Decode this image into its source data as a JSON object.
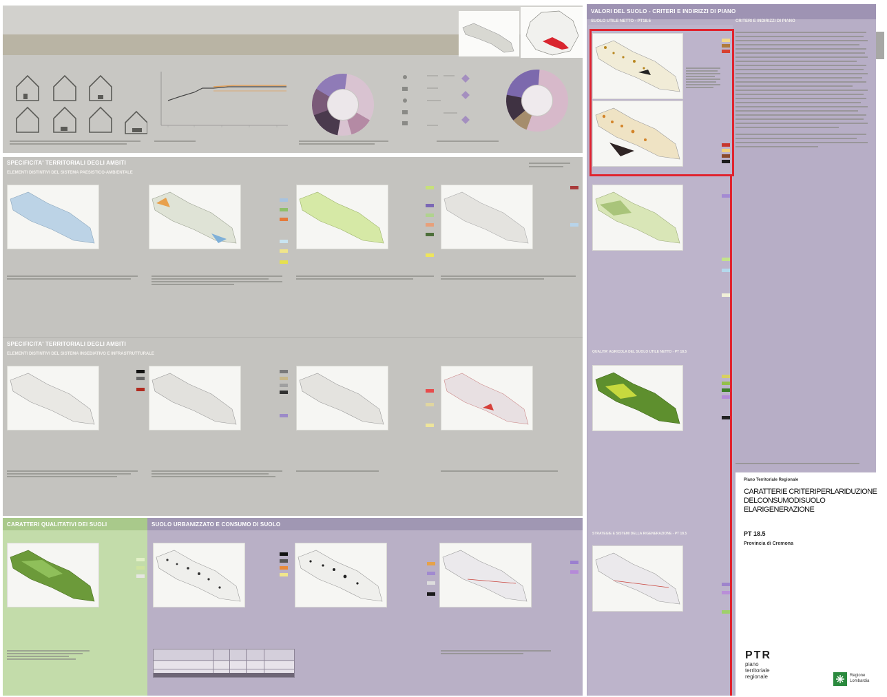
{
  "sections": {
    "top_right_title": "VALORI DEL SUOLO - CRITERI E INDIRIZZI DI PIANO",
    "top_right_sub_left": "SUOLO UTILE NETTO - PT18.5",
    "top_right_sub_right": "CRITERI E INDIRIZZI DI PIANO",
    "spec_ambientale_title": "SPECIFICITA' TERRITORIALI DEGLI AMBITI",
    "spec_ambientale_sub": "ELEMENTI DISTINTIVI DEL SISTEMA PAESISTICO-AMBIENTALE",
    "spec_insed_title": "SPECIFICITA' TERRITORIALI DEGLI AMBITI",
    "spec_insed_sub": "ELEMENTI DISTINTIVI DEL SISTEMA INSEDIATIVO E INFRASTRUTTURALE",
    "qualita_title": "CARATTERI QUALITATIVI DEI SUOLI",
    "urbanizzato_title": "SUOLO URBANIZZATO E CONSUMO DI SUOLO",
    "right_mid_label": "QUALITA' AGRICOLA DEL SUOLO UTILE NETTO - PT 18.5",
    "right_low_label": "STRATEGIE E SISTEMI DELLA RIGENERAZIONE - PT 18.5"
  },
  "title_block": {
    "ente": "Piano Territoriale Regionale",
    "main_title": "CARATTERIE CRITERIPERLARIDUZIONE DELCONSUMODISUOLO ELARIGENERAZIONE",
    "code": "PT 18.5",
    "province": "Provincia di Cremona",
    "ptr_letters": "PTR",
    "ptr_line1": "piano",
    "ptr_line2": "territoriale",
    "ptr_line3": "regionale",
    "regione_line1": "Regione",
    "regione_line2": "Lombardia"
  },
  "colors": {
    "gray_band": "#c4c3bf",
    "gray_band_dark": "#b7b6b1",
    "lilac_band": "#b6adc4",
    "lilac_light": "#c9c1d6",
    "green_band": "#bfd7a6",
    "highlight_red": "#e0232e",
    "map_green_dark": "#5e8f2e",
    "map_green_light": "#cfe3a0",
    "map_blue": "#bcd3e6",
    "donut_purple": "#8e7ab5",
    "donut_dark": "#4a3a4e",
    "donut_pink": "#d7b9c9"
  },
  "icons": {
    "house": "house-icon",
    "donut": "donut-chart",
    "logo_ptr": "ptr-logo",
    "logo_regione": "regione-lombardia-logo"
  }
}
